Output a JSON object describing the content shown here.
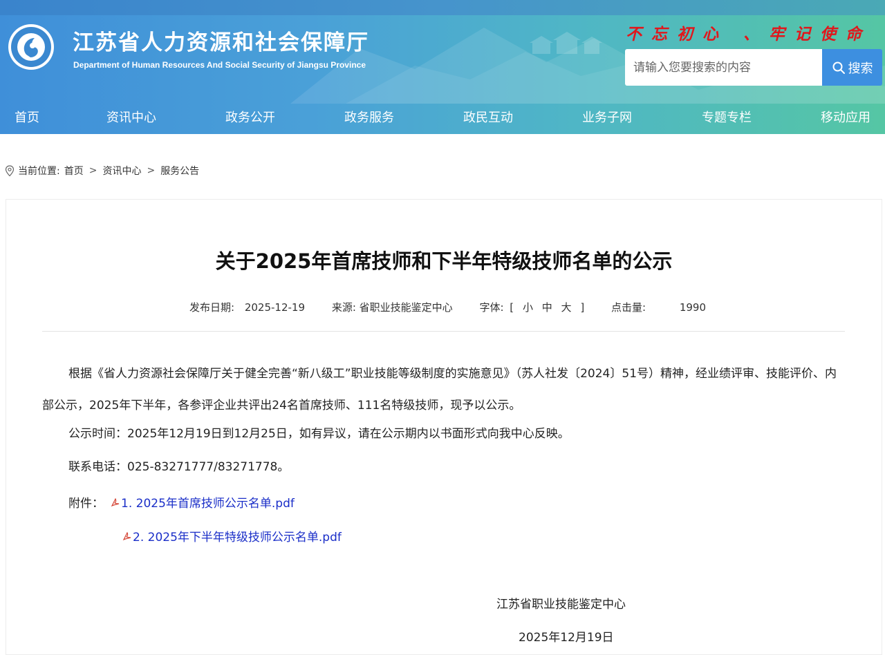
{
  "header": {
    "site_title": "江苏省人力资源和社会保障厅",
    "site_subtitle": "Department of Human Resources And Social Security of Jiangsu Province",
    "slogan": "不忘初心 、牢记使命",
    "search_placeholder": "请输入您要搜索的内容",
    "search_button": "搜索"
  },
  "nav": {
    "items": [
      "首页",
      "资讯中心",
      "政务公开",
      "政务服务",
      "政民互动",
      "业务子网",
      "专题专栏",
      "移动应用"
    ]
  },
  "breadcrumb": {
    "label": "当前位置:",
    "items": [
      "首页",
      "资讯中心",
      "服务公告"
    ],
    "separator": ">"
  },
  "article": {
    "title": "关于2025年首席技师和下半年特级技师名单的公示",
    "meta": {
      "date_label": "发布日期:",
      "date": "2025-12-19",
      "source_label": "来源:",
      "source": "省职业技能鉴定中心",
      "font_label": "字体:",
      "font_open": "[",
      "font_small": "小",
      "font_medium": "中",
      "font_large": "大",
      "font_close": "]",
      "hits_label": "点击量:",
      "hits": "1990"
    },
    "paragraph1": "根据《省人力资源社会保障厅关于健全完善“新八级工”职业技能等级制度的实施意见》（苏人社发〔2024〕51号）精神，经业绩评审、技能评价、内部公示，2025年下半年，各参评企业共评出24名首席技师、111名特级技师，现予以公示。",
    "paragraph2": "公示时间：2025年12月19日到12月25日，如有异议，请在公示期内以书面形式向我中心反映。",
    "paragraph3": "联系电话：025-83271777/83271778。",
    "attachments_label": "附件：",
    "attachments": [
      "1. 2025年首席技师公示名单.pdf",
      "2. 2025年下半年特级技师公示名单.pdf"
    ],
    "signature_org": "江苏省职业技能鉴定中心",
    "signature_date": "2025年12月19日"
  },
  "colors": {
    "slogan": "#e0171c",
    "link": "#1a2ec8",
    "search_button": "#3d8fe0"
  }
}
